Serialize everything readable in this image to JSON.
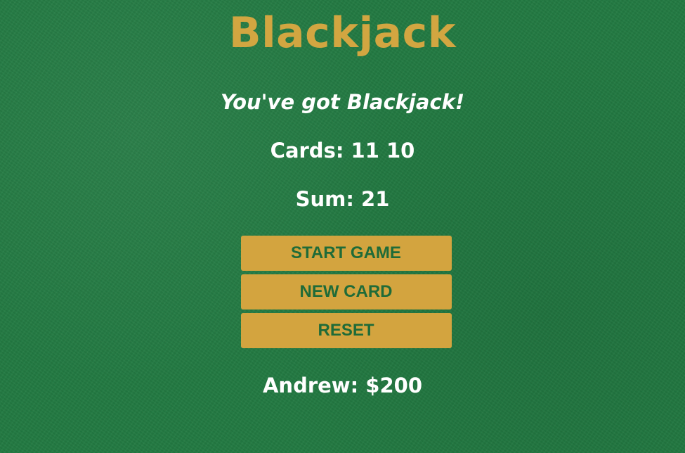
{
  "title": "Blackjack",
  "message": "You've got Blackjack!",
  "cards_text": "Cards: 11 10",
  "sum_text": "Sum: 21",
  "buttons": {
    "start": "START GAME",
    "new_card": "NEW CARD",
    "reset": "RESET"
  },
  "player_text": "Andrew: $200",
  "colors": {
    "felt": "#2a7a43",
    "gold": "#d2a641",
    "button_text": "#1f6b38",
    "text": "#ffffff"
  }
}
